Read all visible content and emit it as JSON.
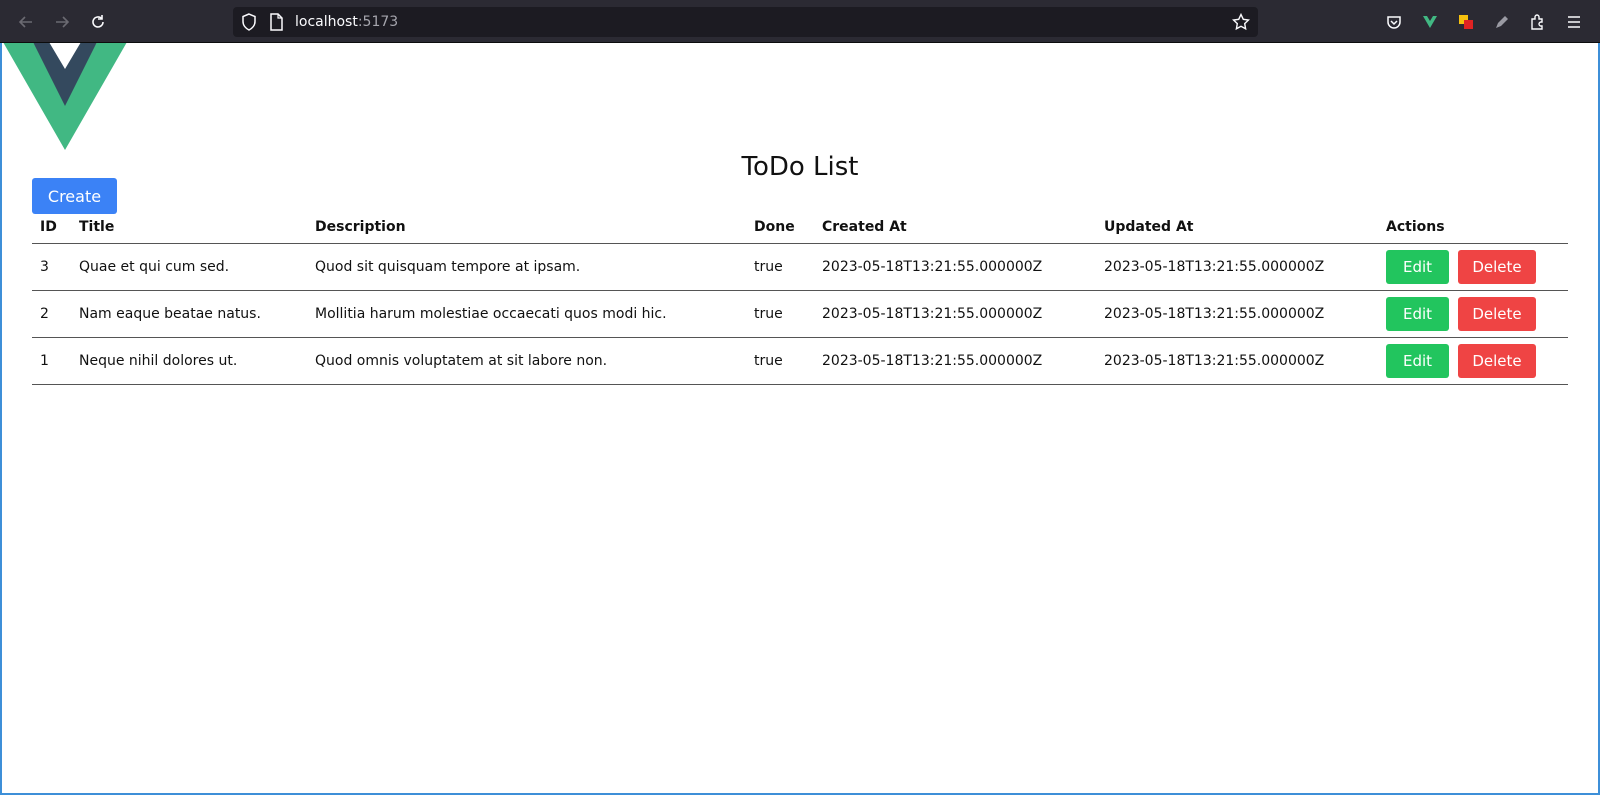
{
  "browser": {
    "url_host": "localhost",
    "url_port": ":5173"
  },
  "page": {
    "title": "ToDo List",
    "create_label": "Create"
  },
  "table": {
    "headers": {
      "id": "ID",
      "title": "Title",
      "description": "Description",
      "done": "Done",
      "created_at": "Created At",
      "updated_at": "Updated At",
      "actions": "Actions"
    },
    "rows": [
      {
        "id": "3",
        "title": "Quae et qui cum sed.",
        "description": "Quod sit quisquam tempore at ipsam.",
        "done": "true",
        "created_at": "2023-05-18T13:21:55.000000Z",
        "updated_at": "2023-05-18T13:21:55.000000Z",
        "edit": "Edit",
        "delete": "Delete"
      },
      {
        "id": "2",
        "title": "Nam eaque beatae natus.",
        "description": "Mollitia harum molestiae occaecati quos modi hic.",
        "done": "true",
        "created_at": "2023-05-18T13:21:55.000000Z",
        "updated_at": "2023-05-18T13:21:55.000000Z",
        "edit": "Edit",
        "delete": "Delete"
      },
      {
        "id": "1",
        "title": "Neque nihil dolores ut.",
        "description": "Quod omnis voluptatem at sit labore non.",
        "done": "true",
        "created_at": "2023-05-18T13:21:55.000000Z",
        "updated_at": "2023-05-18T13:21:55.000000Z",
        "edit": "Edit",
        "delete": "Delete"
      }
    ]
  },
  "colors": {
    "create": "#3b82f6",
    "edit": "#22c55e",
    "delete": "#ef4444",
    "vue_green": "#41b883",
    "vue_dark": "#34495e"
  },
  "icons": [
    "back-arrow-icon",
    "forward-arrow-icon",
    "reload-icon",
    "shield-icon",
    "page-icon",
    "star-icon",
    "pocket-icon",
    "vue-devtools-icon",
    "extension-icon",
    "pen-icon",
    "puzzle-icon",
    "menu-icon",
    "vue-logo"
  ]
}
